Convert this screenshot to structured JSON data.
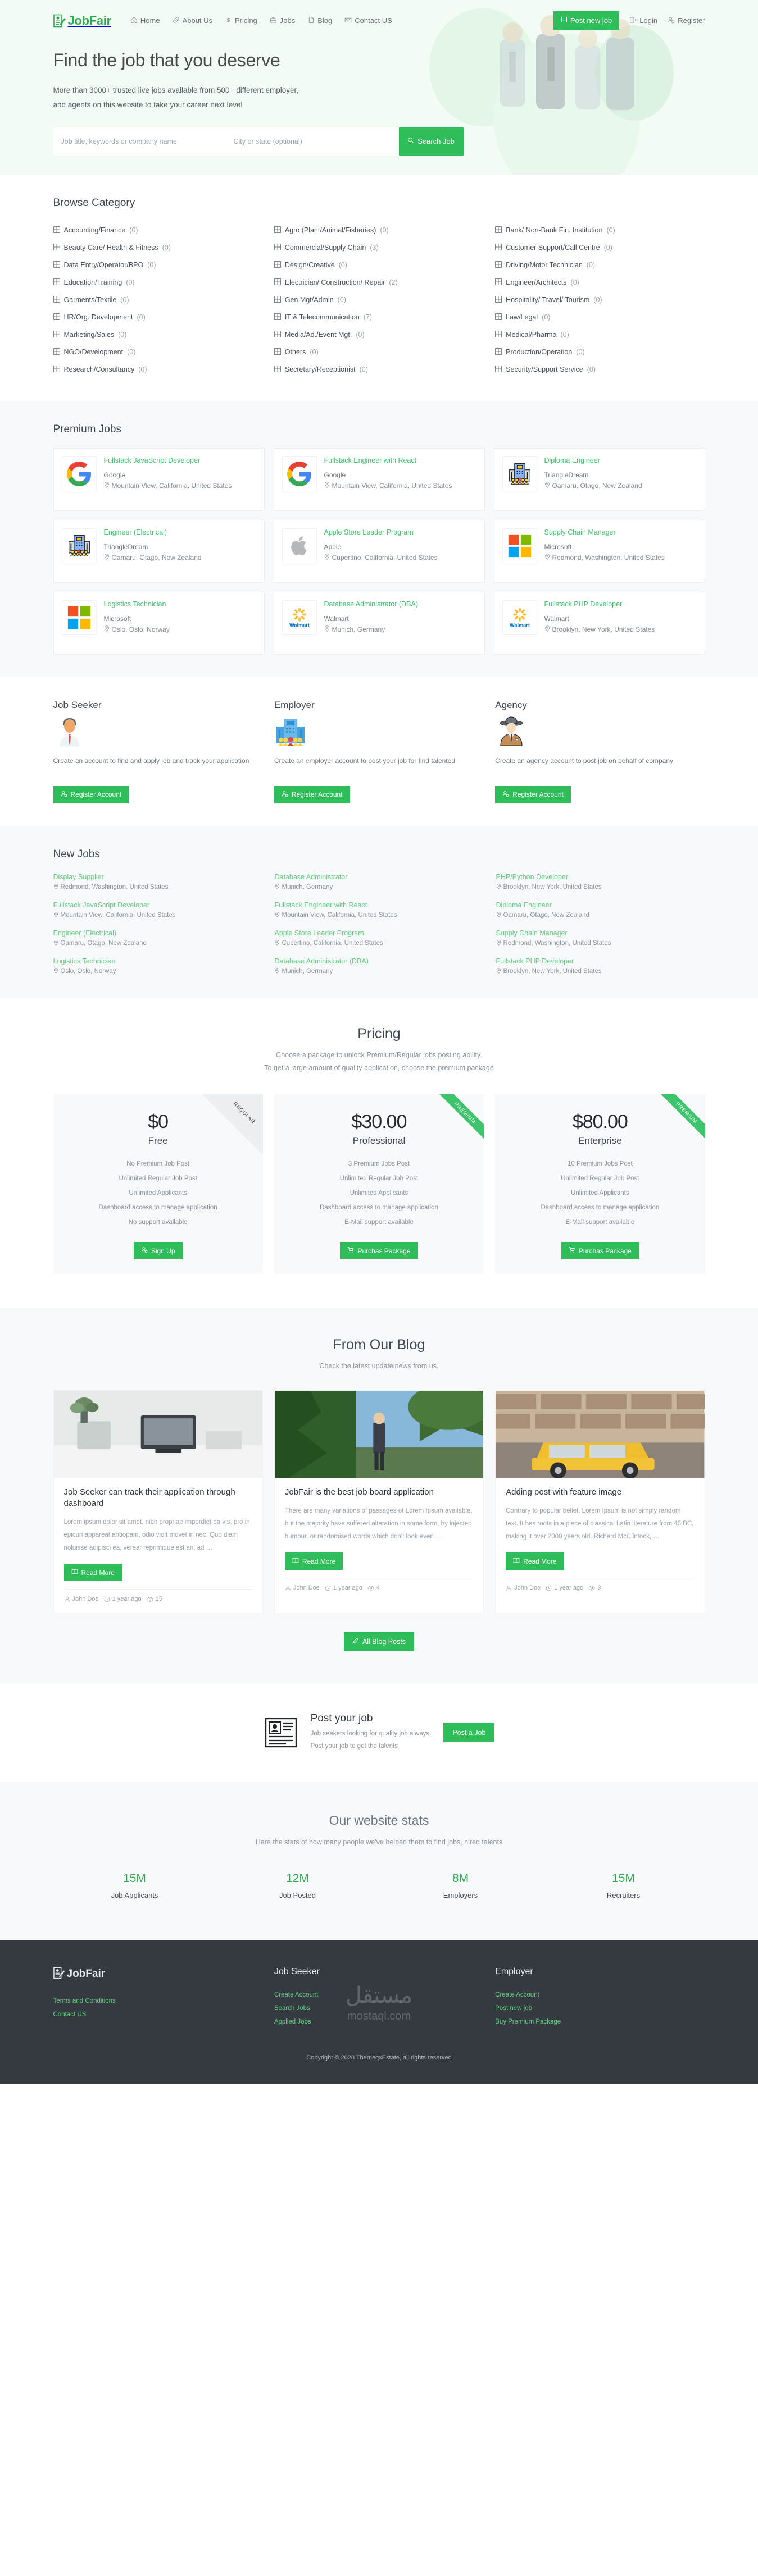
{
  "brand": {
    "name": "JobFair"
  },
  "nav": {
    "links": [
      {
        "label": "Home",
        "icon": "home-icon"
      },
      {
        "label": "About Us",
        "icon": "link-icon"
      },
      {
        "label": "Pricing",
        "icon": "dollar-icon"
      },
      {
        "label": "Jobs",
        "icon": "briefcase-icon"
      },
      {
        "label": "Blog",
        "icon": "file-icon"
      },
      {
        "label": "Contact US",
        "icon": "mail-icon"
      }
    ],
    "post_job": "Post new job",
    "login": "Login",
    "register": "Register"
  },
  "hero": {
    "title": "Find the job that you deserve",
    "sub_line1": "More than 3000+ trusted live jobs available from 500+ different employer,",
    "sub_line2": "and agents on this website to take your career next level",
    "search_placeholder": "Job title, keywords or company name",
    "location_placeholder": "City or state (optional)",
    "search_button": "Search Job"
  },
  "browse": {
    "title": "Browse Category",
    "col1": [
      {
        "label": "Accounting/Finance",
        "count": "(0)"
      },
      {
        "label": "Beauty Care/ Health & Fitness",
        "count": "(0)"
      },
      {
        "label": "Data Entry/Operator/BPO",
        "count": "(0)"
      },
      {
        "label": "Education/Training",
        "count": "(0)"
      },
      {
        "label": "Garments/Textile",
        "count": "(0)"
      },
      {
        "label": "HR/Org. Development",
        "count": "(0)"
      },
      {
        "label": "Marketing/Sales",
        "count": "(0)"
      },
      {
        "label": "NGO/Development",
        "count": "(0)"
      },
      {
        "label": "Research/Consultancy",
        "count": "(0)"
      }
    ],
    "col2": [
      {
        "label": "Agro (Plant/Animal/Fisheries)",
        "count": "(0)"
      },
      {
        "label": "Commercial/Supply Chain",
        "count": "(3)"
      },
      {
        "label": "Design/Creative",
        "count": "(0)"
      },
      {
        "label": "Electrician/ Construction/ Repair",
        "count": "(2)"
      },
      {
        "label": "Gen Mgt/Admin",
        "count": "(0)"
      },
      {
        "label": "IT & Telecommunication",
        "count": "(7)"
      },
      {
        "label": "Media/Ad./Event Mgt.",
        "count": "(0)"
      },
      {
        "label": "Others",
        "count": "(0)"
      },
      {
        "label": "Secretary/Receptionist",
        "count": "(0)"
      }
    ],
    "col3": [
      {
        "label": "Bank/ Non-Bank Fin. Institution",
        "count": "(0)"
      },
      {
        "label": "Customer Support/Call Centre",
        "count": "(0)"
      },
      {
        "label": "Driving/Motor Technician",
        "count": "(0)"
      },
      {
        "label": "Engineer/Architects",
        "count": "(0)"
      },
      {
        "label": "Hospitality/ Travel/ Tourism",
        "count": "(0)"
      },
      {
        "label": "Law/Legal",
        "count": "(0)"
      },
      {
        "label": "Medical/Pharma",
        "count": "(0)"
      },
      {
        "label": "Production/Operation",
        "count": "(0)"
      },
      {
        "label": "Security/Support Service",
        "count": "(0)"
      }
    ]
  },
  "premium": {
    "title": "Premium Jobs",
    "jobs": [
      {
        "title": "Fullstack JavaScript Developer",
        "company": "Google",
        "location": "Mountain View, California, United States",
        "logo": "google-logo"
      },
      {
        "title": "Fullstack Engineer with React",
        "company": "Google",
        "location": "Mountain View, California, United States",
        "logo": "google-logo"
      },
      {
        "title": "Diploma Engineer",
        "company": "TriangleDream",
        "location": "Oamaru, Otago, New Zealand",
        "logo": "building-logo"
      },
      {
        "title": "Engineer (Electrical)",
        "company": "TriangleDream",
        "location": "Oamaru, Otago, New Zealand",
        "logo": "building-logo"
      },
      {
        "title": "Apple Store Leader Program",
        "company": "Apple",
        "location": "Cupertino, California, United States",
        "logo": "apple-logo"
      },
      {
        "title": "Supply Chain Manager",
        "company": "Microsoft",
        "location": "Redmond, Washington, United States",
        "logo": "microsoft-logo"
      },
      {
        "title": "Logistics Technician",
        "company": "Microsoft",
        "location": "Oslo, Oslo, Norway",
        "logo": "microsoft-logo"
      },
      {
        "title": "Database Administrator (DBA)",
        "company": "Walmart",
        "location": "Munich, Germany",
        "logo": "walmart-logo"
      },
      {
        "title": "Fullstack PHP Developer",
        "company": "Walmart",
        "location": "Brooklyn, New York, United States",
        "logo": "walmart-logo"
      }
    ]
  },
  "roles": [
    {
      "title": "Job Seeker",
      "icon": "job-seeker-icon",
      "desc": "Create an account to find and apply job and track your application",
      "button": "Register Account"
    },
    {
      "title": "Employer",
      "icon": "employer-building-icon",
      "desc": "Create an employer account to post your job for find talented",
      "button": "Register Account"
    },
    {
      "title": "Agency",
      "icon": "agency-detective-icon",
      "desc": "Create an agency account to post job on behalf of company",
      "button": "Register Account"
    }
  ],
  "newjobs": {
    "title": "New Jobs",
    "items": [
      {
        "title": "Display Supplier",
        "location": "Redmond, Washington, United States"
      },
      {
        "title": "Database Administrator",
        "location": "Munich, Germany"
      },
      {
        "title": "PHP/Python Developer",
        "location": "Brooklyn, New York, United States"
      },
      {
        "title": "Fullstack JavaScript Developer",
        "location": "Mountain View, California, United States"
      },
      {
        "title": "Fullstack Engineer with React",
        "location": "Mountain View, California, United States"
      },
      {
        "title": "Diploma Engineer",
        "location": "Oamaru, Otago, New Zealand"
      },
      {
        "title": "Engineer (Electrical)",
        "location": "Oamaru, Otago, New Zealand"
      },
      {
        "title": "Apple Store Leader Program",
        "location": "Cupertino, California, United States"
      },
      {
        "title": "Supply Chain Manager",
        "location": "Redmond, Washington, United States"
      },
      {
        "title": "Logistics Technician",
        "location": "Oslo, Oslo, Norway"
      },
      {
        "title": "Database Administrator (DBA)",
        "location": "Munich, Germany"
      },
      {
        "title": "Fullstack PHP Developer",
        "location": "Brooklyn, New York, United States"
      }
    ]
  },
  "pricing": {
    "title": "Pricing",
    "sub_line1": "Choose a package to unlock Premium/Regular jobs posting ability.",
    "sub_line2": "To get a large amount of quality application, choose the premium package",
    "plans": [
      {
        "amount": "$0",
        "name": "Free",
        "ribbon": "REGULAR",
        "ribbon_type": "regular",
        "features": [
          "No Premium Job Post",
          "Unlimited Regular Job Post",
          "Unlimited Applicants",
          "Dashboard access to manage application",
          "No support available"
        ],
        "button": "Sign Up",
        "button_icon": "user-plus-icon"
      },
      {
        "amount": "$30.00",
        "name": "Professional",
        "ribbon": "PREMIUM",
        "ribbon_type": "premium",
        "features": [
          "3 Premium Jobs Post",
          "Unlimited Regular Job Post",
          "Unlimited Applicants",
          "Dashboard access to manage application",
          "E-Mail support available"
        ],
        "button": "Purchas Package",
        "button_icon": "cart-icon"
      },
      {
        "amount": "$80.00",
        "name": "Enterprise",
        "ribbon": "PREMIUM",
        "ribbon_type": "premium",
        "features": [
          "10 Premium Jobs Post",
          "Unlimited Regular Job Post",
          "Unlimited Applicants",
          "Dashboard access to manage application",
          "E-Mail support available"
        ],
        "button": "Purchas Package",
        "button_icon": "cart-icon"
      }
    ]
  },
  "blog": {
    "title": "From Our Blog",
    "subtitle": "Check the latest updatelnews from us.",
    "read_more": "Read More",
    "all_posts": "All Blog Posts",
    "posts": [
      {
        "title": "Job Seeker can track their application through dashboard",
        "excerpt": "Lorem ipsum dolor sit amet, nibh propriae imperdiet ea vis, pro in epicuri appareat antiopam, odio vidit movet in nec. Quo diam noluisse adipisci ea, verear reprimique est an, ad …",
        "author": "John Doe",
        "date": "1 year ago",
        "views": "15",
        "thumb": "desk-plant-photo"
      },
      {
        "title": "JobFair is the best job board application",
        "excerpt": "There are many variations of passages of Lorem Ipsum available, but the majority have suffered alteration in some form, by injected humour, or randomised words which don't look even …",
        "author": "John Doe",
        "date": "1 year ago",
        "views": "4",
        "thumb": "forest-person-photo"
      },
      {
        "title": "Adding post with feature image",
        "excerpt": "Contrary to popular belief, Lorem Ipsum is not simply random text. It has roots in a piece of classical Latin literature from 45 BC, making it over 2000 years old. Richard McClintock, …",
        "author": "John Doe",
        "date": "1 year ago",
        "views": "3",
        "thumb": "yellow-car-photo"
      }
    ]
  },
  "postjob": {
    "title": "Post your job",
    "line1": "Job seekers looking for quality job always.",
    "line2": "Post your job to get the talents",
    "button": "Post a Job"
  },
  "stats": {
    "title": "Our website stats",
    "subtitle": "Here the stats of how many people we've helped them to find jobs, hired talents",
    "items": [
      {
        "value": "15M",
        "label": "Job Applicants"
      },
      {
        "value": "12M",
        "label": "Job Posted"
      },
      {
        "value": "8M",
        "label": "Employers"
      },
      {
        "value": "15M",
        "label": "Recruiters"
      }
    ]
  },
  "footer": {
    "brand": "JobFair",
    "brand_links": [
      "Terms and Conditions",
      "Contact US"
    ],
    "col2_head": "Job Seeker",
    "col2_links": [
      "Create Account",
      "Search Jobs",
      "Applied Jobs"
    ],
    "col3_head": "Employer",
    "col3_links": [
      "Create Account",
      "Post new job",
      "Buy Premium Package"
    ],
    "copyright": "Copyright © 2020 ThemeqxEstate, all rights reserved",
    "watermark_ar": "مستقل",
    "watermark_en": "mostaql.com"
  },
  "colors": {
    "accent": "#2ebd59",
    "accent_light": "#5fcf80",
    "hero_bg": "#f2fcf4",
    "grey_bg": "#f8f9fb",
    "footer_bg": "#343a40"
  }
}
